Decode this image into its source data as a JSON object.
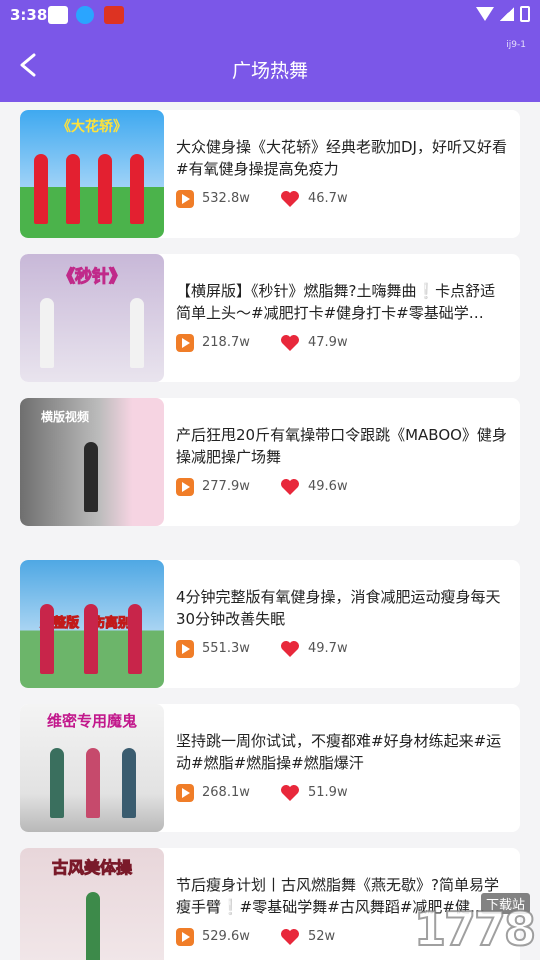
{
  "status_bar": {
    "time": "3:38"
  },
  "header": {
    "title": "广场热舞",
    "corner_tag": "ij9-1"
  },
  "videos": [
    {
      "title": "大众健身操《大花轿》经典老歌加DJ，好听又好看#有氧健身操提高免疫力",
      "plays": "532.8w",
      "likes": "46.7w",
      "thumb_caption": "《大花轿》"
    },
    {
      "title": "【横屏版】《秒针》燃脂舞?土嗨舞曲❕卡点舒适简单上头～#减肥打卡#健身打卡#零基础学…",
      "plays": "218.7w",
      "likes": "47.9w",
      "thumb_caption": "《秒针》"
    },
    {
      "title": "产后狂甩20斤有氧操带口令跟跳《MABOO》健身操减肥操广场舞",
      "plays": "277.9w",
      "likes": "49.6w",
      "thumb_caption": "横版视频"
    },
    {
      "title": "4分钟完整版有氧健身操，消食减肥运动瘦身每天30分钟改善失眠",
      "plays": "551.3w",
      "likes": "49.7w",
      "thumb_caption": "完整版《伤离别》"
    },
    {
      "title": "坚持跳一周你试试，不瘦都难#好身材练起来#运动#燃脂#燃脂操#燃脂爆汗",
      "plays": "268.1w",
      "likes": "51.9w",
      "thumb_caption": "维密专用魔鬼"
    },
    {
      "title": "节后瘦身计划丨古风燃脂舞《燕无歇》?简单易学瘦手臂❕#零基础学舞#古风舞蹈#减肥#健…",
      "plays": "529.6w",
      "likes": "52w",
      "thumb_caption": "古风美体操"
    }
  ],
  "watermark": {
    "digits": "1778",
    "tag": "下载站"
  },
  "colors": {
    "header": "#7b57e8",
    "play_icon": "#f07d28",
    "heart": "#e8283b"
  }
}
